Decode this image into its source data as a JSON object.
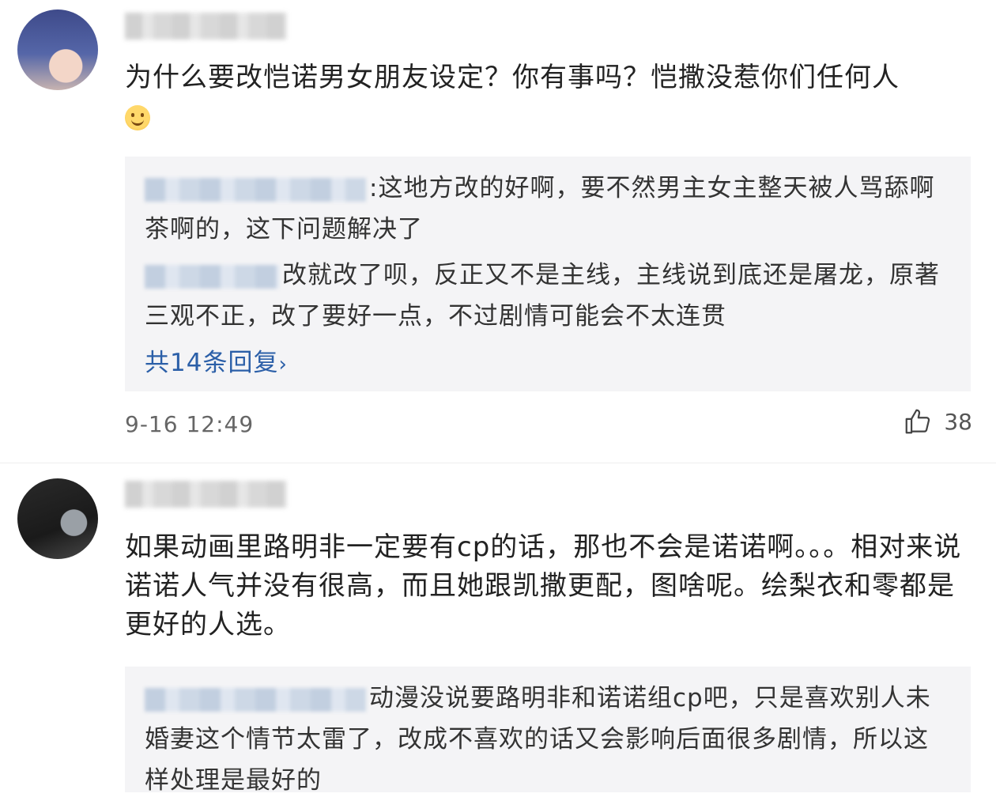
{
  "comments": [
    {
      "text": "为什么要改恺诺男女朋友设定？你有事吗？恺撒没惹你们任何人",
      "emoji": "smile-emoji",
      "replies": [
        {
          "text": ":这地方改的好啊，要不然男主女主整天被人骂舔啊茶啊的，这下问题解决了"
        },
        {
          "text": "改就改了呗，反正又不是主线，主线说到底还是屠龙，原著三观不正，改了要好一点，不过剧情可能会不太连贯"
        }
      ],
      "more_replies": "共14条回复",
      "more_chevron": "›",
      "timestamp": "9-16 12:49",
      "likes": "38"
    },
    {
      "text": "如果动画里路明非一定要有cp的话，那也不会是诺诺啊。。。相对来说诺诺人气并没有很高，而且她跟凯撒更配，图啥呢。绘梨衣和零都是更好的人选。",
      "replies": [
        {
          "text": "动漫没说要路明非和诺诺组cp吧，只是喜欢别人未婚妻这个情节太雷了，改成不喜欢的话又会影响后面很多剧情，所以这样处理是最好的"
        }
      ]
    }
  ],
  "colors": {
    "reply_bg": "#f4f4f6",
    "link": "#2b5fa8",
    "text": "#222222",
    "meta": "#666666"
  }
}
